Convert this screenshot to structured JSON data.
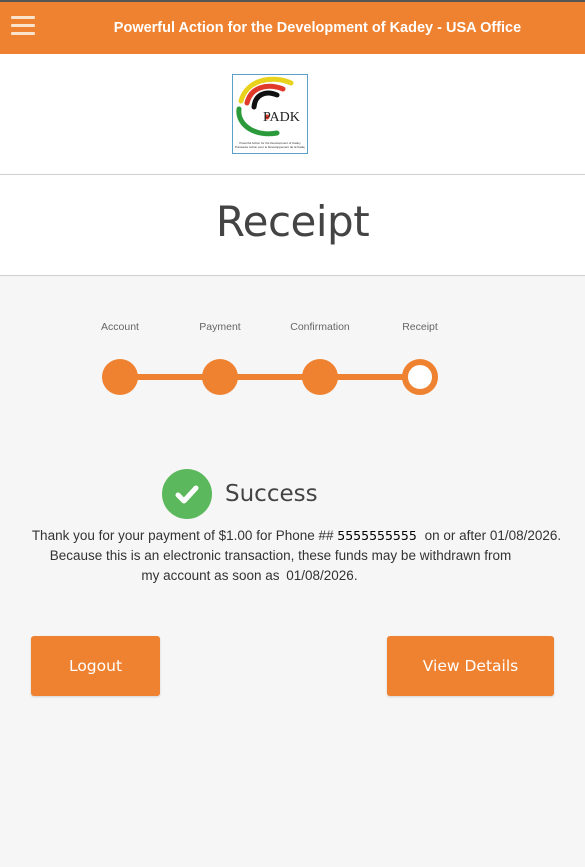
{
  "header": {
    "title": "Powerful Action for the Development of Kadey - USA Office",
    "menu_icon": "hamburger-menu-icon"
  },
  "logo": {
    "letters": "PADK",
    "caption_line1": "Powerful Action for the Development of Kadey",
    "caption_line2": "Puissante Action pour le Développement de la Kadey"
  },
  "page": {
    "title": "Receipt"
  },
  "steps": [
    {
      "label": "Account",
      "state": "complete"
    },
    {
      "label": "Payment",
      "state": "complete"
    },
    {
      "label": "Confirmation",
      "state": "complete"
    },
    {
      "label": "Receipt",
      "state": "current"
    }
  ],
  "status": {
    "icon": "check-circle-icon",
    "text": "Success"
  },
  "message": {
    "line1_prefix": "Thank you for your payment of $1.00 for Phone ##",
    "phone": "5555555555",
    "line1_suffix": "on or after 01/08/2026.",
    "line2": "Because this is an electronic transaction, these funds may be withdrawn from",
    "line3_prefix": "my account as soon as",
    "line3_date": "01/08/2026."
  },
  "buttons": {
    "logout": "Logout",
    "view_details": "View Details"
  },
  "colors": {
    "accent": "#ef8230",
    "success": "#5cb85c",
    "background": "#f6f6f6"
  }
}
